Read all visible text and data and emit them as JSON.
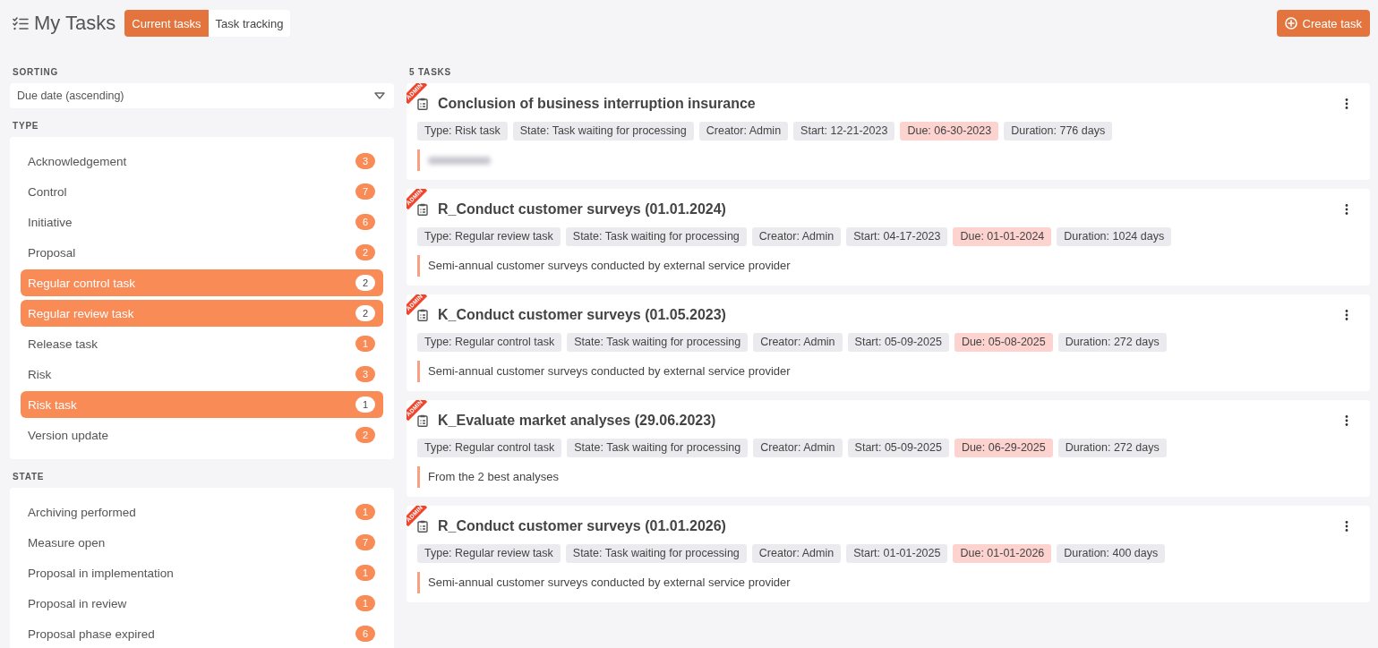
{
  "header": {
    "title": "My Tasks",
    "tabs": [
      {
        "label": "Current tasks",
        "selected": true
      },
      {
        "label": "Task tracking",
        "selected": false
      }
    ],
    "create_button": "Create task"
  },
  "sidebar": {
    "sorting": {
      "label": "SORTING",
      "value": "Due date (ascending)"
    },
    "type": {
      "label": "TYPE",
      "items": [
        {
          "label": "Acknowledgement",
          "count": "3",
          "selected": false
        },
        {
          "label": "Control",
          "count": "7",
          "selected": false
        },
        {
          "label": "Initiative",
          "count": "6",
          "selected": false
        },
        {
          "label": "Proposal",
          "count": "2",
          "selected": false
        },
        {
          "label": "Regular control task",
          "count": "2",
          "selected": true
        },
        {
          "label": "Regular review task",
          "count": "2",
          "selected": true
        },
        {
          "label": "Release task",
          "count": "1",
          "selected": false
        },
        {
          "label": "Risk",
          "count": "3",
          "selected": false
        },
        {
          "label": "Risk task",
          "count": "1",
          "selected": true
        },
        {
          "label": "Version update",
          "count": "2",
          "selected": false
        }
      ]
    },
    "state": {
      "label": "STATE",
      "items": [
        {
          "label": "Archiving performed",
          "count": "1",
          "selected": false
        },
        {
          "label": "Measure open",
          "count": "7",
          "selected": false
        },
        {
          "label": "Proposal in implementation",
          "count": "1",
          "selected": false
        },
        {
          "label": "Proposal in review",
          "count": "1",
          "selected": false
        },
        {
          "label": "Proposal phase expired",
          "count": "6",
          "selected": false
        }
      ]
    }
  },
  "tasks": {
    "count_label": "5 TASKS",
    "items": [
      {
        "ribbon": "ADMIN",
        "title": "Conclusion of business interruption insurance",
        "tags": [
          {
            "text": "Type: Risk task",
            "highlighted": false
          },
          {
            "text": "State: Task waiting for processing",
            "highlighted": false
          },
          {
            "text": "Creator: Admin",
            "highlighted": false
          },
          {
            "text": "Start: 12-21-2023",
            "highlighted": false
          },
          {
            "text": "Due: 06-30-2023",
            "highlighted": true
          },
          {
            "text": "Duration: 776 days",
            "highlighted": false
          }
        ],
        "description_blurred": true
      },
      {
        "ribbon": "ADMIN",
        "title": "R_Conduct customer surveys (01.01.2024)",
        "tags": [
          {
            "text": "Type: Regular review task",
            "highlighted": false
          },
          {
            "text": "State: Task waiting for processing",
            "highlighted": false
          },
          {
            "text": "Creator: Admin",
            "highlighted": false
          },
          {
            "text": "Start: 04-17-2023",
            "highlighted": false
          },
          {
            "text": "Due: 01-01-2024",
            "highlighted": true
          },
          {
            "text": "Duration: 1024 days",
            "highlighted": false
          }
        ],
        "description": "Semi-annual customer surveys conducted by external service provider",
        "description_blurred": false
      },
      {
        "ribbon": "ADMIN",
        "title": "K_Conduct customer surveys (01.05.2023)",
        "tags": [
          {
            "text": "Type: Regular control task",
            "highlighted": false
          },
          {
            "text": "State: Task waiting for processing",
            "highlighted": false
          },
          {
            "text": "Creator: Admin",
            "highlighted": false
          },
          {
            "text": "Start: 05-09-2025",
            "highlighted": false
          },
          {
            "text": "Due: 05-08-2025",
            "highlighted": true
          },
          {
            "text": "Duration: 272 days",
            "highlighted": false
          }
        ],
        "description": "Semi-annual customer surveys conducted by external service provider",
        "description_blurred": false
      },
      {
        "ribbon": "ADMIN",
        "title": "K_Evaluate market analyses (29.06.2023)",
        "tags": [
          {
            "text": "Type: Regular control task",
            "highlighted": false
          },
          {
            "text": "State: Task waiting for processing",
            "highlighted": false
          },
          {
            "text": "Creator: Admin",
            "highlighted": false
          },
          {
            "text": "Start: 05-09-2025",
            "highlighted": false
          },
          {
            "text": "Due: 06-29-2025",
            "highlighted": true
          },
          {
            "text": "Duration: 272 days",
            "highlighted": false
          }
        ],
        "description": "From the 2 best analyses",
        "description_blurred": false
      },
      {
        "ribbon": "ADMIN",
        "title": "R_Conduct customer surveys (01.01.2026)",
        "tags": [
          {
            "text": "Type: Regular review task",
            "highlighted": false
          },
          {
            "text": "State: Task waiting for processing",
            "highlighted": false
          },
          {
            "text": "Creator: Admin",
            "highlighted": false
          },
          {
            "text": "Start: 01-01-2025",
            "highlighted": false
          },
          {
            "text": "Due: 01-01-2026",
            "highlighted": true
          },
          {
            "text": "Duration: 400 days",
            "highlighted": false
          }
        ],
        "description": "Semi-annual customer surveys conducted by external service provider",
        "description_blurred": false
      }
    ]
  }
}
